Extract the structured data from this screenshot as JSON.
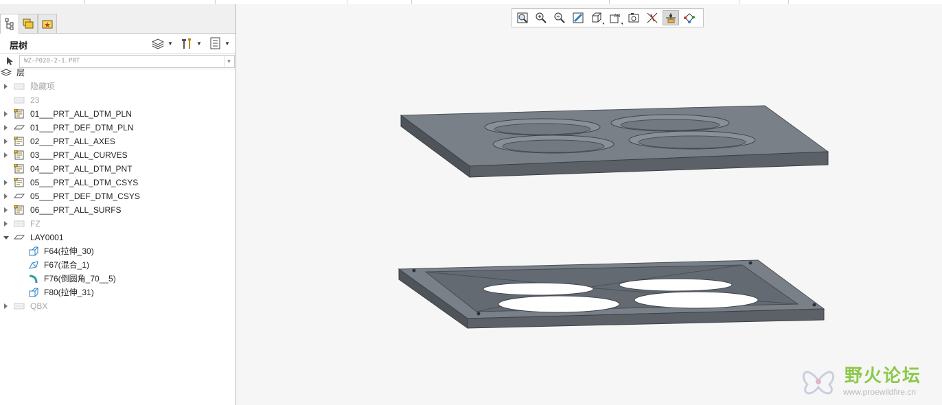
{
  "layer_tree": {
    "title": "层树",
    "model_name": "WZ-P020-2-1.PRT",
    "root_label": "层",
    "items": [
      {
        "label": "隐藏项",
        "expandable": true,
        "icon": "layer-dim-icon",
        "dim": true
      },
      {
        "label": "23",
        "expandable": false,
        "icon": "layer-dim-icon",
        "dim": true
      },
      {
        "label": "01___PRT_ALL_DTM_PLN",
        "expandable": true,
        "icon": "rule-layer-icon"
      },
      {
        "label": "01___PRT_DEF_DTM_PLN",
        "expandable": true,
        "icon": "layer-icon"
      },
      {
        "label": "02___PRT_ALL_AXES",
        "expandable": true,
        "icon": "rule-layer-icon"
      },
      {
        "label": "03___PRT_ALL_CURVES",
        "expandable": true,
        "icon": "rule-layer-icon"
      },
      {
        "label": "04___PRT_ALL_DTM_PNT",
        "expandable": false,
        "icon": "rule-layer-icon"
      },
      {
        "label": "05___PRT_ALL_DTM_CSYS",
        "expandable": true,
        "icon": "rule-layer-icon"
      },
      {
        "label": "05___PRT_DEF_DTM_CSYS",
        "expandable": true,
        "icon": "layer-icon"
      },
      {
        "label": "06___PRT_ALL_SURFS",
        "expandable": true,
        "icon": "rule-layer-icon"
      },
      {
        "label": "FZ",
        "expandable": true,
        "icon": "layer-dim-icon",
        "dim": true
      },
      {
        "label": "LAY0001",
        "expandable": true,
        "open": true,
        "icon": "layer-icon"
      },
      {
        "label": "F64(拉伸_30)",
        "child": true,
        "icon": "extrude-feature-icon"
      },
      {
        "label": "F67(混合_1)",
        "child": true,
        "icon": "blend-feature-icon"
      },
      {
        "label": "F76(倒圆角_70__5)",
        "child": true,
        "icon": "round-feature-icon"
      },
      {
        "label": "F80(拉伸_31)",
        "child": true,
        "icon": "extrude-feature-icon"
      },
      {
        "label": "QBX",
        "expandable": true,
        "icon": "layer-dim-icon",
        "dim": true
      }
    ]
  },
  "view_toolbar": [
    {
      "name": "refit-icon"
    },
    {
      "name": "zoom-in-icon"
    },
    {
      "name": "zoom-out-icon"
    },
    {
      "name": "repaint-icon"
    },
    {
      "name": "display-style-icon",
      "dropdown": true
    },
    {
      "name": "saved-views-icon",
      "dropdown": true
    },
    {
      "name": "view-manager-icon"
    },
    {
      "name": "datum-display-icon"
    },
    {
      "name": "spin-center-icon",
      "active": true
    },
    {
      "name": "annotation-display-icon"
    }
  ],
  "watermark": {
    "title": "野火论坛",
    "url": "www.proewildfire.cn"
  },
  "colors": {
    "plate_dark": "#5a6068",
    "plate_top": "#767c84",
    "accent_green": "#8cc94a"
  }
}
